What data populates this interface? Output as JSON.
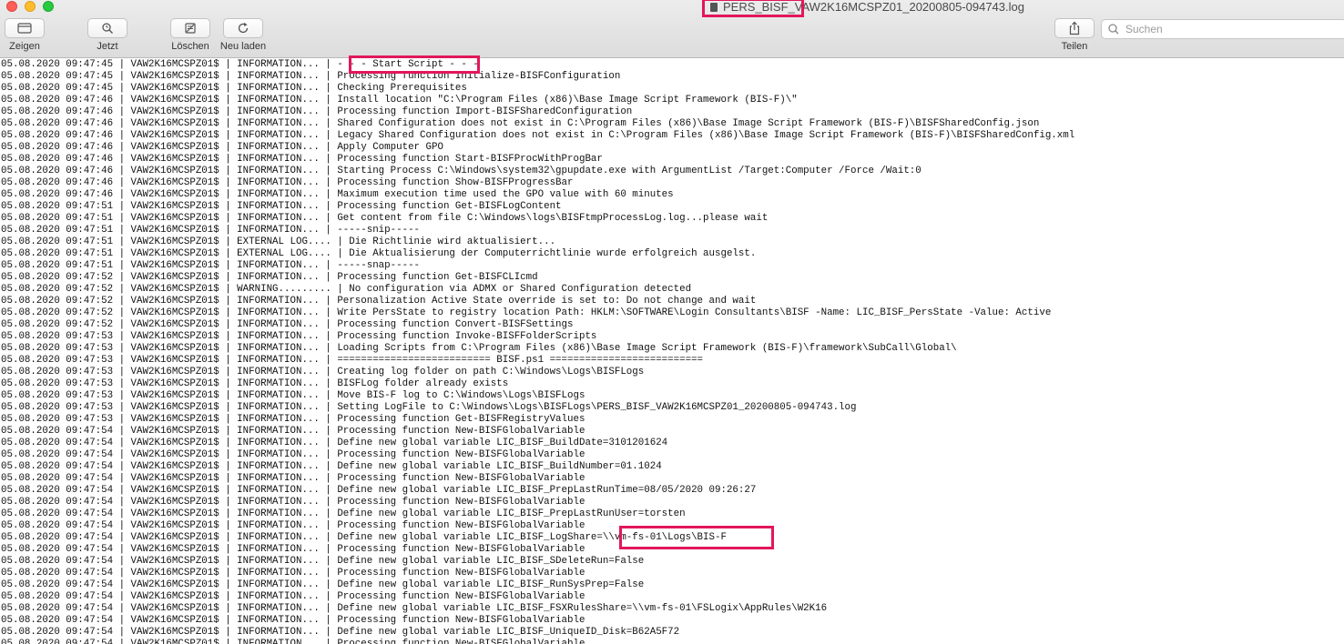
{
  "window": {
    "title": "PERS_BISF_VAW2K16MCSPZ01_20200805-094743.log"
  },
  "toolbar": {
    "show_label": "Zeigen",
    "now_label": "Jetzt",
    "clear_label": "Löschen",
    "reload_label": "Neu laden",
    "share_label": "Teilen",
    "search_placeholder": "Suchen"
  },
  "log_lines": [
    "05.08.2020 09:47:45 | VAW2K16MCSPZ01$ | INFORMATION... | - - - Start Script - - -",
    "05.08.2020 09:47:45 | VAW2K16MCSPZ01$ | INFORMATION... | Processing function Initialize-BISFConfiguration",
    "05.08.2020 09:47:45 | VAW2K16MCSPZ01$ | INFORMATION... | Checking Prerequisites",
    "05.08.2020 09:47:46 | VAW2K16MCSPZ01$ | INFORMATION... | Install location \"C:\\Program Files (x86)\\Base Image Script Framework (BIS-F)\\\"",
    "05.08.2020 09:47:46 | VAW2K16MCSPZ01$ | INFORMATION... | Processing function Import-BISFSharedConfiguration",
    "05.08.2020 09:47:46 | VAW2K16MCSPZ01$ | INFORMATION... | Shared Configuration does not exist in C:\\Program Files (x86)\\Base Image Script Framework (BIS-F)\\BISFSharedConfig.json",
    "05.08.2020 09:47:46 | VAW2K16MCSPZ01$ | INFORMATION... | Legacy Shared Configuration does not exist in C:\\Program Files (x86)\\Base Image Script Framework (BIS-F)\\BISFSharedConfig.xml",
    "05.08.2020 09:47:46 | VAW2K16MCSPZ01$ | INFORMATION... | Apply Computer GPO",
    "05.08.2020 09:47:46 | VAW2K16MCSPZ01$ | INFORMATION... | Processing function Start-BISFProcWithProgBar",
    "05.08.2020 09:47:46 | VAW2K16MCSPZ01$ | INFORMATION... | Starting Process C:\\Windows\\system32\\gpupdate.exe with ArgumentList /Target:Computer /Force /Wait:0",
    "05.08.2020 09:47:46 | VAW2K16MCSPZ01$ | INFORMATION... | Processing function Show-BISFProgressBar",
    "05.08.2020 09:47:46 | VAW2K16MCSPZ01$ | INFORMATION... | Maximum execution time used the GPO value with 60 minutes",
    "05.08.2020 09:47:51 | VAW2K16MCSPZ01$ | INFORMATION... | Processing function Get-BISFLogContent",
    "05.08.2020 09:47:51 | VAW2K16MCSPZ01$ | INFORMATION... | Get content from file C:\\Windows\\logs\\BISFtmpProcessLog.log...please wait",
    "05.08.2020 09:47:51 | VAW2K16MCSPZ01$ | INFORMATION... | -----snip-----",
    "05.08.2020 09:47:51 | VAW2K16MCSPZ01$ | EXTERNAL LOG.... | Die Richtlinie wird aktualisiert...",
    "05.08.2020 09:47:51 | VAW2K16MCSPZ01$ | EXTERNAL LOG.... | Die Aktualisierung der Computerrichtlinie wurde erfolgreich ausgelst.",
    "05.08.2020 09:47:51 | VAW2K16MCSPZ01$ | INFORMATION... | -----snap-----",
    "05.08.2020 09:47:52 | VAW2K16MCSPZ01$ | INFORMATION... | Processing function Get-BISFCLIcmd",
    "05.08.2020 09:47:52 | VAW2K16MCSPZ01$ | WARNING......... | No configuration via ADMX or Shared Configuration detected",
    "05.08.2020 09:47:52 | VAW2K16MCSPZ01$ | INFORMATION... | Personalization Active State override is set to: Do not change and wait",
    "05.08.2020 09:47:52 | VAW2K16MCSPZ01$ | INFORMATION... | Write PersState to registry location Path: HKLM:\\SOFTWARE\\Login Consultants\\BISF -Name: LIC_BISF_PersState -Value: Active",
    "05.08.2020 09:47:52 | VAW2K16MCSPZ01$ | INFORMATION... | Processing function Convert-BISFSettings",
    "05.08.2020 09:47:53 | VAW2K16MCSPZ01$ | INFORMATION... | Processing function Invoke-BISFFolderScripts",
    "05.08.2020 09:47:53 | VAW2K16MCSPZ01$ | INFORMATION... | Loading Scripts from C:\\Program Files (x86)\\Base Image Script Framework (BIS-F)\\framework\\SubCall\\Global\\",
    "05.08.2020 09:47:53 | VAW2K16MCSPZ01$ | INFORMATION... | ========================== BISF.ps1 ==========================",
    "05.08.2020 09:47:53 | VAW2K16MCSPZ01$ | INFORMATION... | Creating log folder on path C:\\Windows\\Logs\\BISFLogs",
    "05.08.2020 09:47:53 | VAW2K16MCSPZ01$ | INFORMATION... | BISFLog folder already exists",
    "05.08.2020 09:47:53 | VAW2K16MCSPZ01$ | INFORMATION... | Move BIS-F log to C:\\Windows\\Logs\\BISFLogs",
    "05.08.2020 09:47:53 | VAW2K16MCSPZ01$ | INFORMATION... | Setting LogFile to C:\\Windows\\Logs\\BISFLogs\\PERS_BISF_VAW2K16MCSPZ01_20200805-094743.log",
    "05.08.2020 09:47:53 | VAW2K16MCSPZ01$ | INFORMATION... | Processing function Get-BISFRegistryValues",
    "05.08.2020 09:47:54 | VAW2K16MCSPZ01$ | INFORMATION... | Processing function New-BISFGlobalVariable",
    "05.08.2020 09:47:54 | VAW2K16MCSPZ01$ | INFORMATION... | Define new global variable LIC_BISF_BuildDate=3101201624",
    "05.08.2020 09:47:54 | VAW2K16MCSPZ01$ | INFORMATION... | Processing function New-BISFGlobalVariable",
    "05.08.2020 09:47:54 | VAW2K16MCSPZ01$ | INFORMATION... | Define new global variable LIC_BISF_BuildNumber=01.1024",
    "05.08.2020 09:47:54 | VAW2K16MCSPZ01$ | INFORMATION... | Processing function New-BISFGlobalVariable",
    "05.08.2020 09:47:54 | VAW2K16MCSPZ01$ | INFORMATION... | Define new global variable LIC_BISF_PrepLastRunTime=08/05/2020 09:26:27",
    "05.08.2020 09:47:54 | VAW2K16MCSPZ01$ | INFORMATION... | Processing function New-BISFGlobalVariable",
    "05.08.2020 09:47:54 | VAW2K16MCSPZ01$ | INFORMATION... | Define new global variable LIC_BISF_PrepLastRunUser=torsten",
    "05.08.2020 09:47:54 | VAW2K16MCSPZ01$ | INFORMATION... | Processing function New-BISFGlobalVariable",
    "05.08.2020 09:47:54 | VAW2K16MCSPZ01$ | INFORMATION... | Define new global variable LIC_BISF_LogShare=\\\\vm-fs-01\\Logs\\BIS-F",
    "05.08.2020 09:47:54 | VAW2K16MCSPZ01$ | INFORMATION... | Processing function New-BISFGlobalVariable",
    "05.08.2020 09:47:54 | VAW2K16MCSPZ01$ | INFORMATION... | Define new global variable LIC_BISF_SDeleteRun=False",
    "05.08.2020 09:47:54 | VAW2K16MCSPZ01$ | INFORMATION... | Processing function New-BISFGlobalVariable",
    "05.08.2020 09:47:54 | VAW2K16MCSPZ01$ | INFORMATION... | Define new global variable LIC_BISF_RunSysPrep=False",
    "05.08.2020 09:47:54 | VAW2K16MCSPZ01$ | INFORMATION... | Processing function New-BISFGlobalVariable",
    "05.08.2020 09:47:54 | VAW2K16MCSPZ01$ | INFORMATION... | Define new global variable LIC_BISF_FSXRulesShare=\\\\vm-fs-01\\FSLogix\\AppRules\\W2K16",
    "05.08.2020 09:47:54 | VAW2K16MCSPZ01$ | INFORMATION... | Processing function New-BISFGlobalVariable",
    "05.08.2020 09:47:54 | VAW2K16MCSPZ01$ | INFORMATION... | Define new global variable LIC_BISF_UniqueID_Disk=B62A5F72",
    "05.08.2020 09:47:54 | VAW2K16MCSPZ01$ | INFORMATION... | Processing function New-BISFGlobalVariable"
  ]
}
